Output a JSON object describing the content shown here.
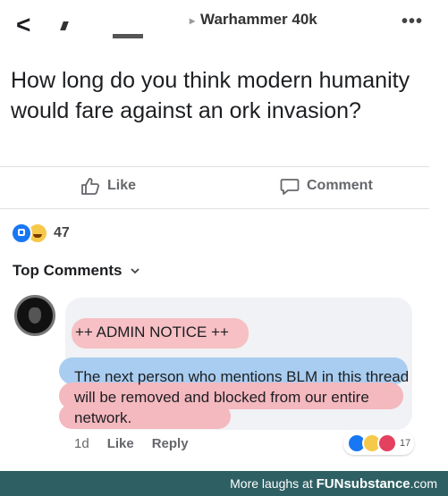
{
  "header": {
    "back_icon": "chevron-left-icon",
    "group_arrow": "▸",
    "group_name": "Warhammer 40k",
    "more_icon": "•••"
  },
  "post": {
    "text": "How long do you think modern humanity would fare against an ork invasion?"
  },
  "actions": {
    "like_label": "Like",
    "comment_label": "Comment"
  },
  "reactions": {
    "types": [
      "like",
      "haha"
    ],
    "count": "47"
  },
  "comments": {
    "header": "Top Comments",
    "items": [
      {
        "admin_notice": "++ ADMIN NOTICE ++",
        "text": "The next person who mentions BLM in this thread will be removed and blocked from our entire network.",
        "time": "1d",
        "like_label": "Like",
        "reply_label": "Reply",
        "reaction_types": [
          "like",
          "haha",
          "love"
        ],
        "reaction_count": "17"
      }
    ]
  },
  "footer": {
    "prefix": "More laughs at ",
    "brand": "FUNsubstance",
    "suffix": ".com"
  },
  "colors": {
    "like_blue": "#1877f2",
    "highlight_pink": "#f4b8bf",
    "highlight_blue": "#a9cdf0",
    "footer_bg": "#2e5f63"
  }
}
